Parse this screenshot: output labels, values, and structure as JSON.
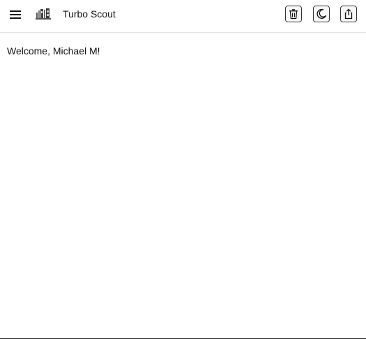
{
  "header": {
    "app_title": "Turbo Scout",
    "menu_icon": "hamburger-menu-icon",
    "logo_icon": "app-logo-icon",
    "actions": [
      {
        "name": "trash-icon"
      },
      {
        "name": "moon-icon"
      },
      {
        "name": "share-icon"
      }
    ]
  },
  "main": {
    "welcome_text": "Welcome, Michael M!"
  }
}
